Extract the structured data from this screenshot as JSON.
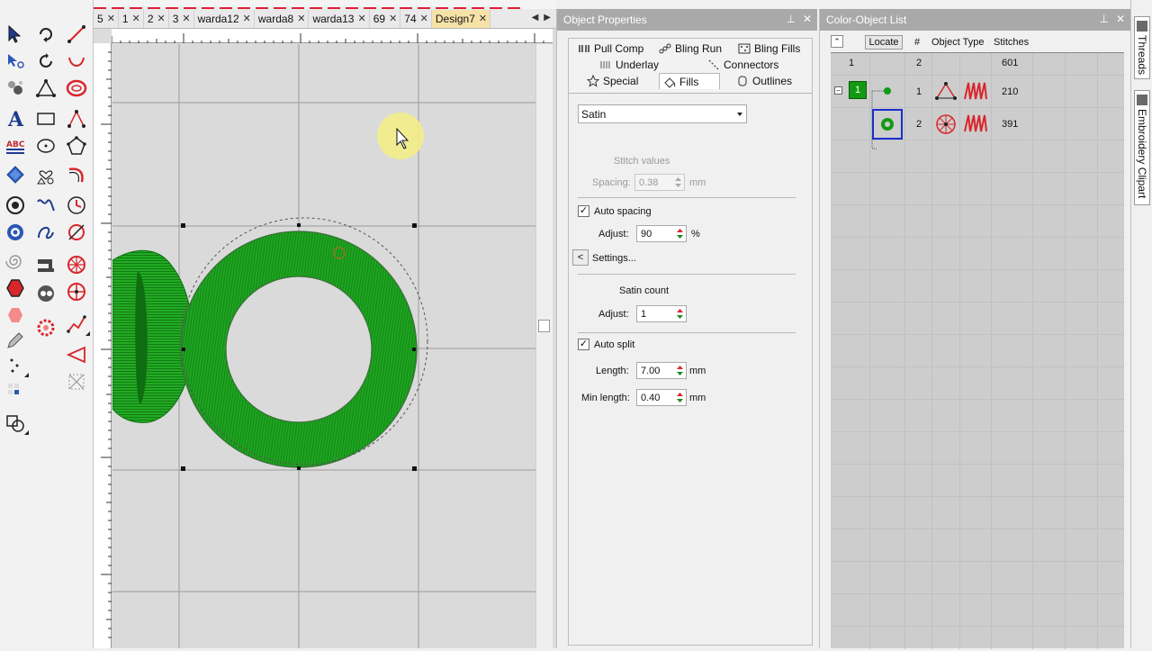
{
  "doc_tabs": [
    {
      "label": "5",
      "active": false
    },
    {
      "label": "1",
      "active": false
    },
    {
      "label": "2",
      "active": false
    },
    {
      "label": "3",
      "active": false
    },
    {
      "label": "warda12",
      "active": false
    },
    {
      "label": "warda8",
      "active": false
    },
    {
      "label": "warda13",
      "active": false
    },
    {
      "label": "69",
      "active": false
    },
    {
      "label": "74",
      "active": false
    },
    {
      "label": "Design7",
      "active": true
    }
  ],
  "object_properties": {
    "title": "Object Properties",
    "tabs": {
      "pull_comp": "Pull Comp",
      "bling_run": "Bling Run",
      "bling_fills": "Bling Fills",
      "underlay": "Underlay",
      "connectors": "Connectors",
      "special": "Special",
      "fills": "Fills",
      "outlines": "Outlines"
    },
    "fill_type": "Satin",
    "stitch_values_heading": "Stitch values",
    "spacing_label": "Spacing:",
    "spacing_value": "0.38",
    "unit_mm": "mm",
    "auto_spacing_label": "Auto spacing",
    "auto_spacing_checked": true,
    "adjust_label": "Adjust:",
    "adjust_value": "90",
    "percent": "%",
    "settings_button_symbol": "<",
    "settings_label": "Settings...",
    "satin_count_heading": "Satin count",
    "satin_adjust_value": "1",
    "auto_split_label": "Auto split",
    "auto_split_checked": true,
    "length_label": "Length:",
    "length_value": "7.00",
    "min_length_label": "Min length:",
    "min_length_value": "0.40"
  },
  "color_object_list": {
    "title": "Color-Object List",
    "locate_label": "Locate",
    "col_num": "#",
    "col_type": "Object Type",
    "col_stitches": "Stitches",
    "summary": {
      "colors": "1",
      "objects": "2",
      "stitches": "601"
    },
    "color_block": "1",
    "rows": [
      {
        "num": "1",
        "stitches": "210"
      },
      {
        "num": "2",
        "stitches": "391"
      }
    ],
    "thread_color": "#139a13"
  },
  "side_tabs": {
    "threads": "Threads",
    "clipart": "Embroidery Clipart"
  },
  "colors": {
    "green": "#1fa51f",
    "dark_green": "#0f6e10",
    "accent_red": "#d8262b",
    "tab_active": "#f7e2a8"
  }
}
